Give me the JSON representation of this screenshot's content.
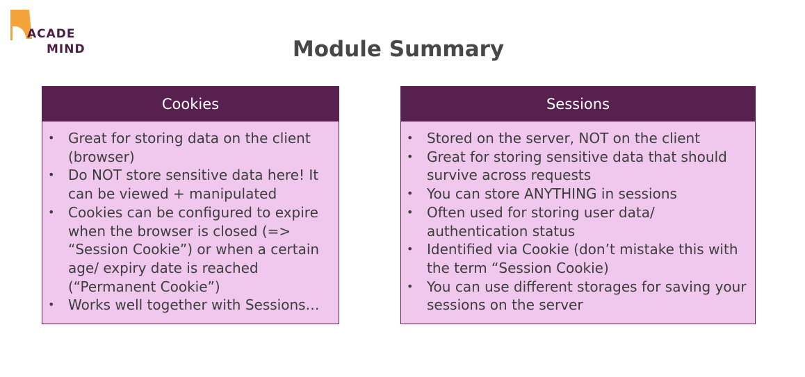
{
  "logo": {
    "line1": "ACADE",
    "line2": "MIND",
    "colors": {
      "mark": "#f3a33a",
      "text": "#4a1f47"
    }
  },
  "title": "Module Summary",
  "panels": {
    "cookies": {
      "header": "Cookies",
      "items": [
        "Great for storing data on the client (browser)",
        "Do NOT store sensitive data here! It can be viewed + manipulated",
        "Cookies can be configured to expire when the browser is closed (=> “Session Cookie”) or when a certain age/ expiry date is reached (“Permanent Cookie”)",
        "Works well together with Sessions…"
      ]
    },
    "sessions": {
      "header": "Sessions",
      "items": [
        "Stored on the server, NOT on the client",
        "Great for storing sensitive data that should survive across requests",
        "You can store ANYTHING in sessions",
        "Often used for storing user data/ authentication status",
        "Identified via Cookie (don’t mistake this with the term “Session Cookie)",
        "You can use different storages for saving your sessions on the server"
      ]
    }
  },
  "colors": {
    "header_bg": "#57204f",
    "panel_bg": "#f0c8ee",
    "title": "#474747",
    "text": "#3d3d3d"
  }
}
